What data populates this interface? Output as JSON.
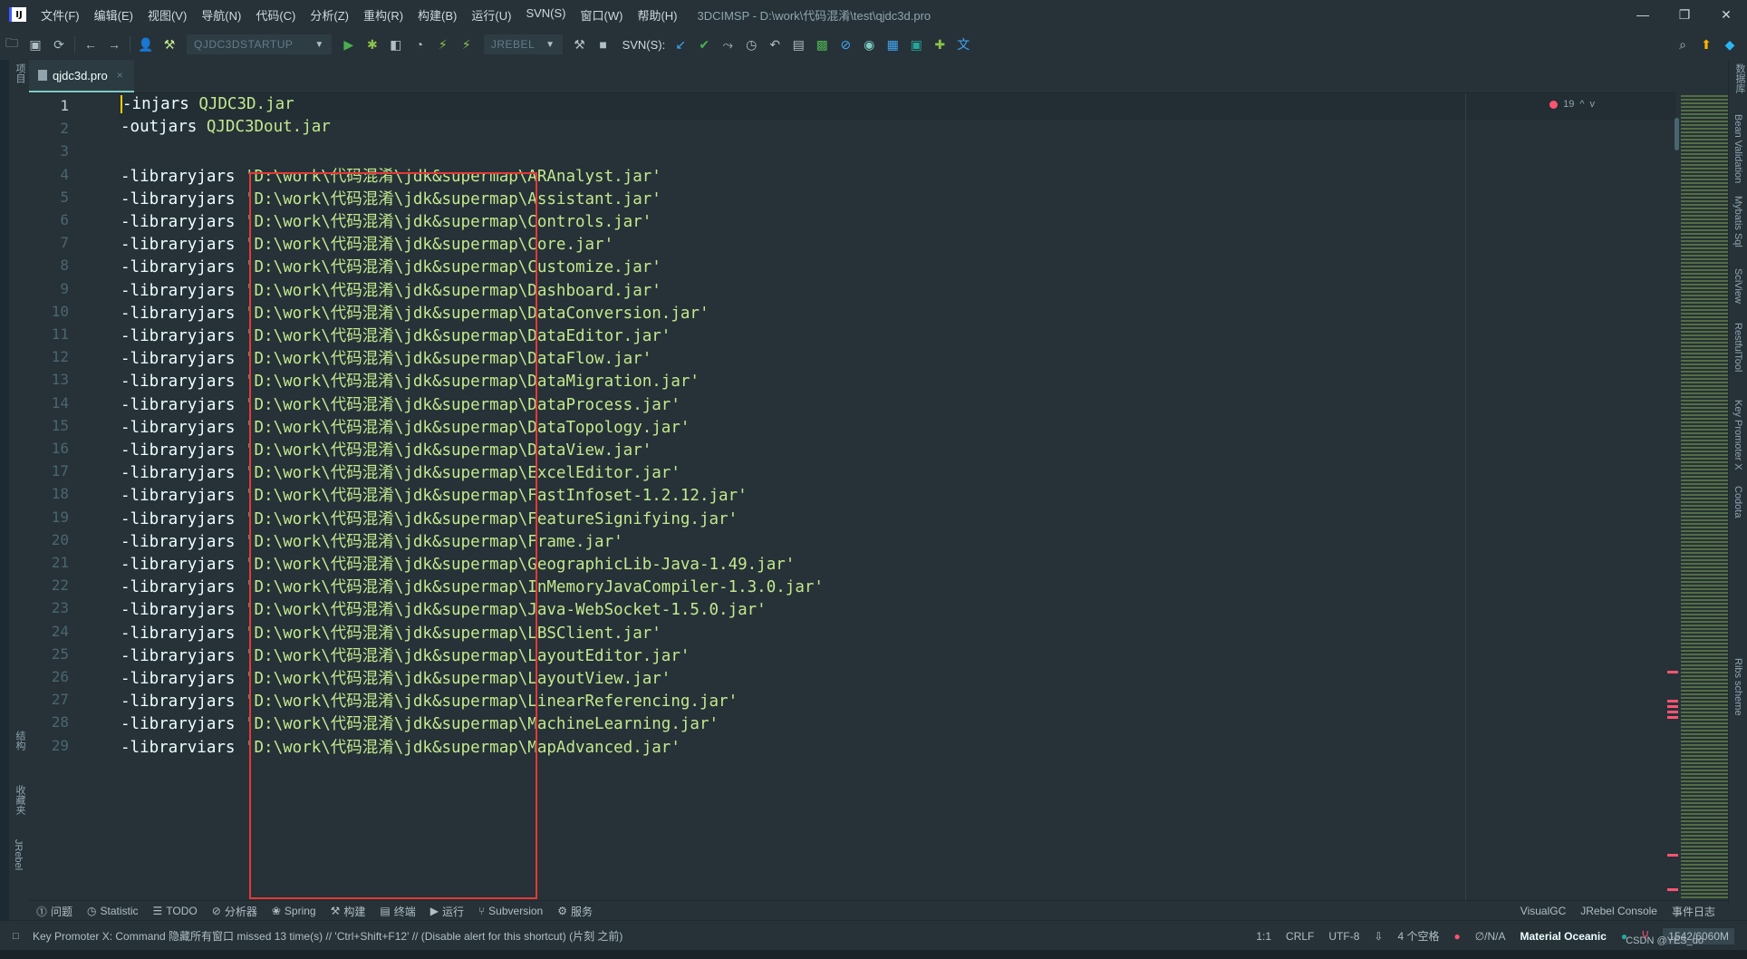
{
  "titlebar": {
    "logo": "IJ",
    "menu": [
      "文件(F)",
      "编辑(E)",
      "视图(V)",
      "导航(N)",
      "代码(C)",
      "分析(Z)",
      "重构(R)",
      "构建(B)",
      "运行(U)",
      "SVN(S)",
      "窗口(W)",
      "帮助(H)"
    ],
    "title": "3DCIMSP - D:\\work\\代码混淆\\test\\qjdc3d.pro",
    "controls": {
      "minimize": "—",
      "restore": "❐",
      "close": "✕"
    }
  },
  "toolbar": {
    "run_config": "QJDC3DSTARTUP",
    "jrebel_config": "JREBEL",
    "svn_label": "SVN(S):"
  },
  "left_tools": {
    "project": "项目",
    "structure": "结构",
    "favorites": "收藏夹",
    "jrebel": "JRebel"
  },
  "right_tools": [
    "数据库",
    "Bean Validation",
    "Mybatis Sql",
    "SciView",
    "RestfulTool",
    "Key Promoter X",
    "Codota",
    "Ribs scheme"
  ],
  "tab": {
    "label": "qjdc3d.pro",
    "close": "×"
  },
  "inspection": {
    "count": "19",
    "up": "^",
    "down": "v"
  },
  "editor": {
    "lines": [
      {
        "num": "1",
        "opt": "-injars",
        "val": "QJDC3D.jar"
      },
      {
        "num": "2",
        "opt": "-outjars",
        "val": "QJDC3Dout.jar"
      },
      {
        "num": "3",
        "opt": "",
        "val": ""
      },
      {
        "num": "4",
        "opt": "-libraryjars",
        "val": "'D:\\work\\代码混淆\\jdk&supermap\\ARAnalyst.jar'"
      },
      {
        "num": "5",
        "opt": "-libraryjars",
        "val": "'D:\\work\\代码混淆\\jdk&supermap\\Assistant.jar'"
      },
      {
        "num": "6",
        "opt": "-libraryjars",
        "val": "'D:\\work\\代码混淆\\jdk&supermap\\Controls.jar'"
      },
      {
        "num": "7",
        "opt": "-libraryjars",
        "val": "'D:\\work\\代码混淆\\jdk&supermap\\Core.jar'"
      },
      {
        "num": "8",
        "opt": "-libraryjars",
        "val": "'D:\\work\\代码混淆\\jdk&supermap\\Customize.jar'"
      },
      {
        "num": "9",
        "opt": "-libraryjars",
        "val": "'D:\\work\\代码混淆\\jdk&supermap\\Dashboard.jar'"
      },
      {
        "num": "10",
        "opt": "-libraryjars",
        "val": "'D:\\work\\代码混淆\\jdk&supermap\\DataConversion.jar'"
      },
      {
        "num": "11",
        "opt": "-libraryjars",
        "val": "'D:\\work\\代码混淆\\jdk&supermap\\DataEditor.jar'"
      },
      {
        "num": "12",
        "opt": "-libraryjars",
        "val": "'D:\\work\\代码混淆\\jdk&supermap\\DataFlow.jar'"
      },
      {
        "num": "13",
        "opt": "-libraryjars",
        "val": "'D:\\work\\代码混淆\\jdk&supermap\\DataMigration.jar'"
      },
      {
        "num": "14",
        "opt": "-libraryjars",
        "val": "'D:\\work\\代码混淆\\jdk&supermap\\DataProcess.jar'"
      },
      {
        "num": "15",
        "opt": "-libraryjars",
        "val": "'D:\\work\\代码混淆\\jdk&supermap\\DataTopology.jar'"
      },
      {
        "num": "16",
        "opt": "-libraryjars",
        "val": "'D:\\work\\代码混淆\\jdk&supermap\\DataView.jar'"
      },
      {
        "num": "17",
        "opt": "-libraryjars",
        "val": "'D:\\work\\代码混淆\\jdk&supermap\\ExcelEditor.jar'"
      },
      {
        "num": "18",
        "opt": "-libraryjars",
        "val": "'D:\\work\\代码混淆\\jdk&supermap\\FastInfoset-1.2.12.jar'"
      },
      {
        "num": "19",
        "opt": "-libraryjars",
        "val": "'D:\\work\\代码混淆\\jdk&supermap\\FeatureSignifying.jar'"
      },
      {
        "num": "20",
        "opt": "-libraryjars",
        "val": "'D:\\work\\代码混淆\\jdk&supermap\\Frame.jar'"
      },
      {
        "num": "21",
        "opt": "-libraryjars",
        "val": "'D:\\work\\代码混淆\\jdk&supermap\\GeographicLib-Java-1.49.jar'"
      },
      {
        "num": "22",
        "opt": "-libraryjars",
        "val": "'D:\\work\\代码混淆\\jdk&supermap\\InMemoryJavaCompiler-1.3.0.jar'"
      },
      {
        "num": "23",
        "opt": "-libraryjars",
        "val": "'D:\\work\\代码混淆\\jdk&supermap\\Java-WebSocket-1.5.0.jar'"
      },
      {
        "num": "24",
        "opt": "-libraryjars",
        "val": "'D:\\work\\代码混淆\\jdk&supermap\\LBSClient.jar'"
      },
      {
        "num": "25",
        "opt": "-libraryjars",
        "val": "'D:\\work\\代码混淆\\jdk&supermap\\LayoutEditor.jar'"
      },
      {
        "num": "26",
        "opt": "-libraryjars",
        "val": "'D:\\work\\代码混淆\\jdk&supermap\\LayoutView.jar'"
      },
      {
        "num": "27",
        "opt": "-libraryjars",
        "val": "'D:\\work\\代码混淆\\jdk&supermap\\LinearReferencing.jar'"
      },
      {
        "num": "28",
        "opt": "-libraryjars",
        "val": "'D:\\work\\代码混淆\\jdk&supermap\\MachineLearning.jar'"
      },
      {
        "num": "29",
        "opt": "-librarviars",
        "val": "'D:\\work\\代码混淆\\jdk&supermap\\MapAdvanced.jar'"
      }
    ]
  },
  "bottom_tools": {
    "left": [
      "问题",
      "Statistic",
      "TODO",
      "分析器",
      "Spring",
      "构建",
      "终端",
      "运行",
      "Subversion",
      "服务"
    ],
    "right": [
      "VisualGC",
      "JRebel Console",
      "事件日志"
    ]
  },
  "status": {
    "message": "Key Promoter X: Command 隐藏所有窗口 missed 13 time(s) // 'Ctrl+Shift+F12' // (Disable alert for this shortcut) (片刻 之前)",
    "position": "1:1",
    "line_sep": "CRLF",
    "encoding": "UTF-8",
    "indent": "4 个空格",
    "vcs": "∅/N/A",
    "theme": "Material Oceanic",
    "memory": "1542/6060M"
  },
  "watermark": "CSDN @YES_do",
  "colors": {
    "accent": "#80cbc4",
    "string": "#c3e88d",
    "error": "#ff5370",
    "highlight_box": "#e53935"
  }
}
